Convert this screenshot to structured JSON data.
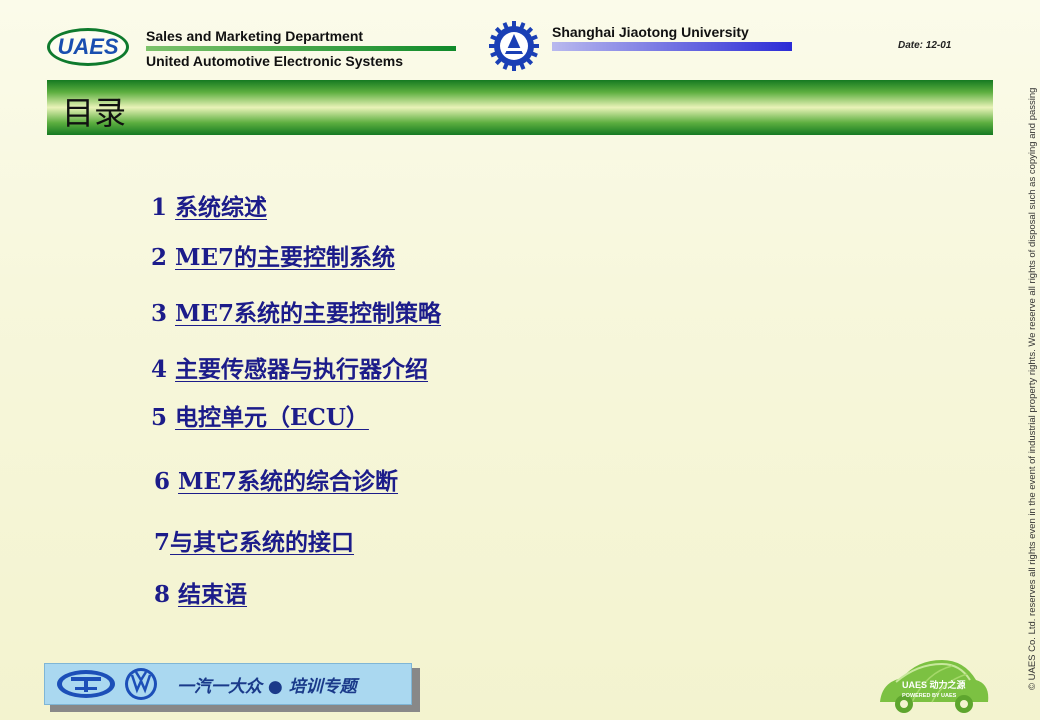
{
  "header": {
    "logo_text": "UAES",
    "dept_line1": "Sales and Marketing Department",
    "dept_line2": "United Automotive Electronic Systems",
    "university": "Shanghai Jiaotong University",
    "date": "Date: 12-01"
  },
  "title": "目录",
  "toc": [
    {
      "num": "1 ",
      "label": "系统综述"
    },
    {
      "num": "2 ",
      "label": "ME7的主要控制系统"
    },
    {
      "num": "3 ",
      "label": "ME7系统的主要控制策略"
    },
    {
      "num": "4 ",
      "label": "主要传感器与执行器介绍"
    },
    {
      "num": "5 ",
      "label": "电控单元（ECU）"
    },
    {
      "num": "6 ",
      "label": "ME7系统的综合诊断"
    },
    {
      "num": "7",
      "label": "与其它系统的接口"
    },
    {
      "num": "8 ",
      "label": "结束语"
    }
  ],
  "copyright": "© UAES Co. Ltd. reserves all rights even in the event of industrial property rights. We reserve all rights of disposal such as copying and passing",
  "footer": {
    "text": "一汽一大众 ● 培训专题",
    "car_logo_line1": "UAES 动力之源",
    "car_logo_line2": "POWERED BY UAES"
  },
  "colors": {
    "link": "#1c1c8a",
    "green_bar": "#157a22",
    "blue_bar": "#2b2bd6",
    "footer_bg": "#aad8f0"
  },
  "icons": [
    "uaes-logo",
    "sjtu-emblem-icon",
    "faw-logo-icon",
    "vw-logo-icon",
    "uaes-car-logo"
  ]
}
